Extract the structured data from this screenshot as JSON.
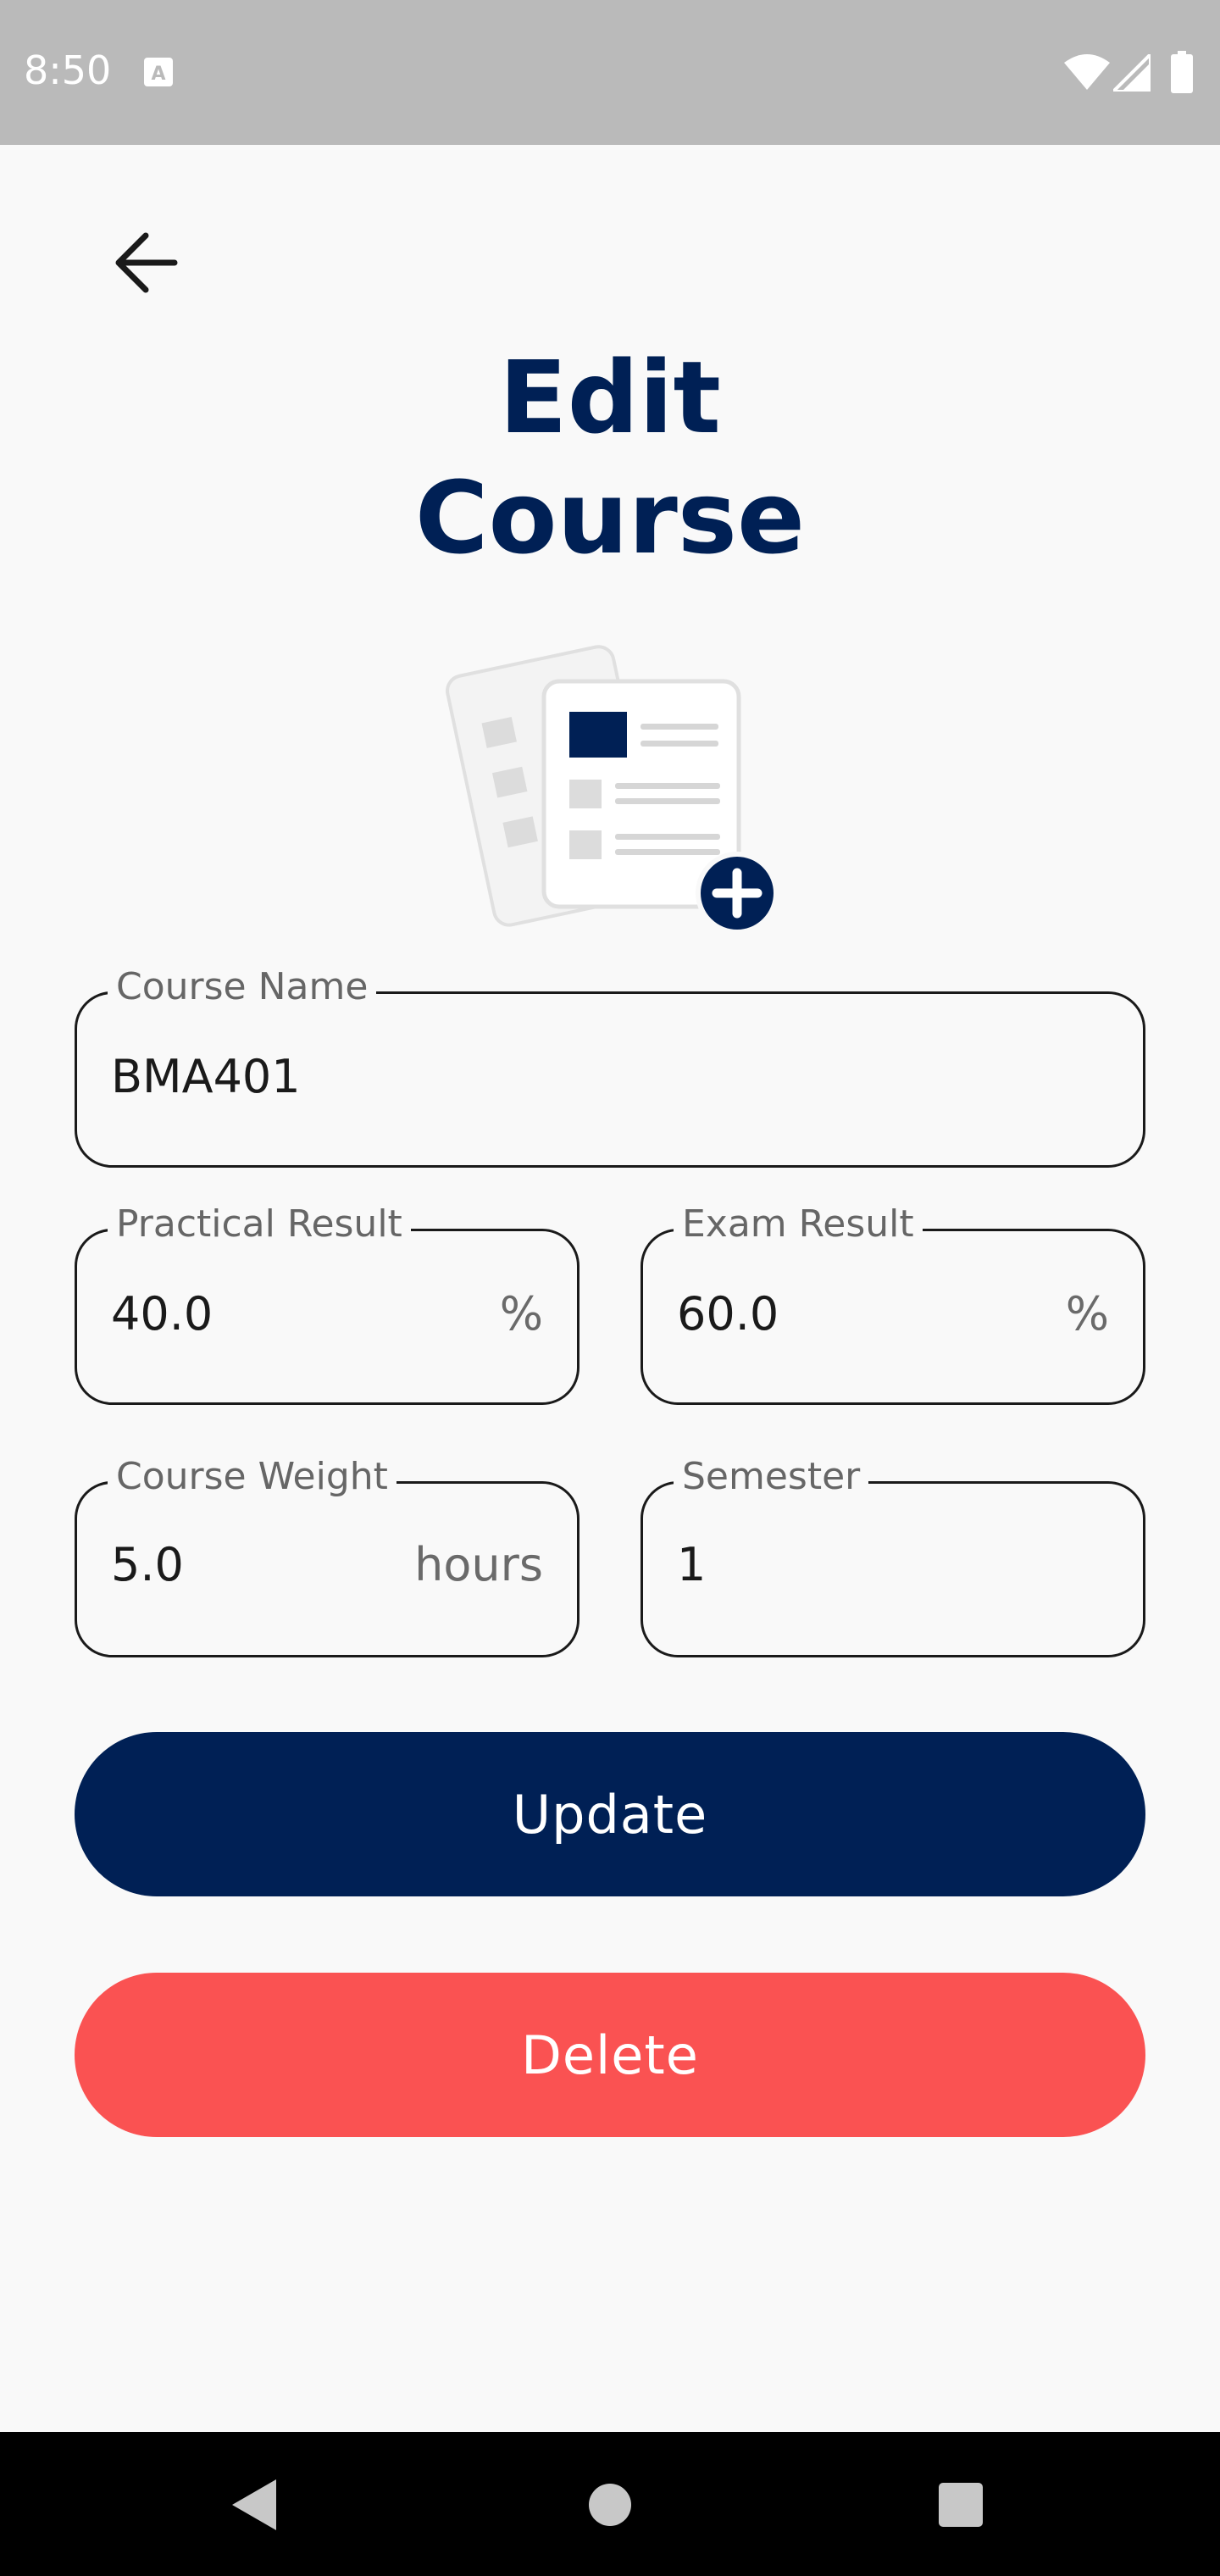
{
  "status_bar": {
    "time": "8:50",
    "icons": [
      "a-notification-icon",
      "wifi-icon",
      "signal-icon",
      "battery-icon"
    ]
  },
  "header": {
    "back_icon": "arrow-left-icon",
    "title": "Edit\nCourse"
  },
  "illustration": {
    "icon": "add-document-icon",
    "accent_color": "#002055"
  },
  "form": {
    "course_name": {
      "label": "Course Name",
      "value": "BMA401"
    },
    "practical_result": {
      "label": "Practical Result",
      "value": "40.0",
      "suffix": "%"
    },
    "exam_result": {
      "label": "Exam Result",
      "value": "60.0",
      "suffix": "%"
    },
    "course_weight": {
      "label": "Course Weight",
      "value": "5.0",
      "suffix": "hours"
    },
    "semester": {
      "label": "Semester",
      "value": "1"
    }
  },
  "buttons": {
    "update_label": "Update",
    "delete_label": "Delete"
  },
  "colors": {
    "primary": "#002055",
    "danger": "#fa5252",
    "background": "#f9f9f9",
    "status_bar": "#bababa"
  },
  "nav_bar": {
    "icons": [
      "nav-back-icon",
      "nav-home-icon",
      "nav-recents-icon"
    ]
  }
}
